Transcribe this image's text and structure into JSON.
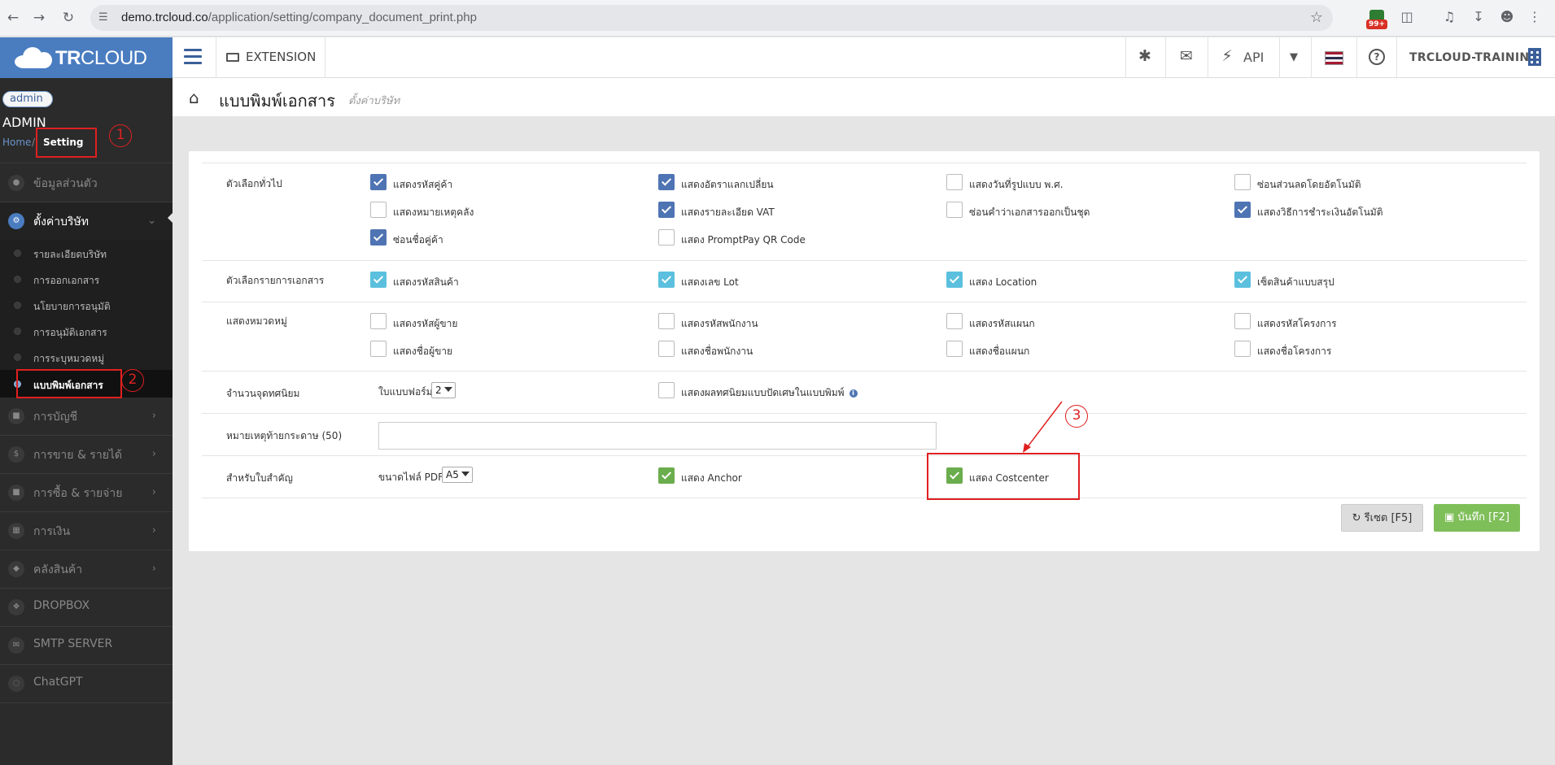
{
  "browser": {
    "url_host": "demo.trcloud.co",
    "url_path": "/application/setting/company_document_print.php",
    "ext_badge": "99+"
  },
  "topbar": {
    "brand_bold": "TR",
    "brand_rest": "CLOUD",
    "extension_label": "EXTENSION",
    "api_label": "API",
    "company_name": "TRCLOUD-TRAINING"
  },
  "sidebar": {
    "avatar_alt": "admin",
    "user": "ADMIN",
    "crumb_home": "Home",
    "crumb_current": "Setting",
    "items": [
      {
        "label": "ข้อมูลส่วนตัว"
      },
      {
        "label": "ตั้งค่าบริษัท"
      },
      {
        "label": "การบัญชี"
      },
      {
        "label": "การขาย & รายได้"
      },
      {
        "label": "การซื้อ & รายจ่าย"
      },
      {
        "label": "การเงิน"
      },
      {
        "label": "คลังสินค้า"
      },
      {
        "label": "DROPBOX"
      },
      {
        "label": "SMTP SERVER"
      },
      {
        "label": "ChatGPT"
      }
    ],
    "subitems": [
      {
        "label": "รายละเอียดบริษัท"
      },
      {
        "label": "การออกเอกสาร"
      },
      {
        "label": "นโยบายการอนุมัติ"
      },
      {
        "label": "การอนุมัติเอกสาร"
      },
      {
        "label": "การระบุหมวดหมู่"
      },
      {
        "label": "แบบพิมพ์เอกสาร"
      }
    ]
  },
  "page": {
    "title": "แบบพิมพ์เอกสาร",
    "subtitle": "ตั้งค่าบริษัท"
  },
  "form": {
    "general": {
      "label": "ตัวเลือกทั่วไป",
      "options": [
        {
          "label": "แสดงรหัสคู่ค้า",
          "checked": true
        },
        {
          "label": "แสดงอัตราแลกเปลี่ยน",
          "checked": true
        },
        {
          "label": "แสดงวันที่รูปแบบ พ.ศ.",
          "checked": false
        },
        {
          "label": "ซ่อนส่วนลดโดยอัตโนมัติ",
          "checked": false
        },
        {
          "label": "แสดงหมายเหตุคลัง",
          "checked": false
        },
        {
          "label": "แสดงรายละเอียด VAT",
          "checked": true
        },
        {
          "label": "ซ่อนคำว่าเอกสารออกเป็นชุด",
          "checked": false
        },
        {
          "label": "แสดงวิธีการชำระเงินอัตโนมัติ",
          "checked": true
        },
        {
          "label": "ซ่อนชื่อคู่ค้า",
          "checked": true
        },
        {
          "label": "แสดง PromptPay QR Code",
          "checked": false
        }
      ]
    },
    "items": {
      "label": "ตัวเลือกรายการเอกสาร",
      "options": [
        {
          "label": "แสดงรหัสสินค้า",
          "checked": true
        },
        {
          "label": "แสดงเลข Lot",
          "checked": true
        },
        {
          "label": "แสดง Location",
          "checked": true
        },
        {
          "label": "เซ็ตสินค้าแบบสรุป",
          "checked": true
        }
      ]
    },
    "category": {
      "label": "แสดงหมวดหมู่",
      "options": [
        {
          "label": "แสดงรหัสผู้ขาย",
          "checked": false
        },
        {
          "label": "แสดงรหัสพนักงาน",
          "checked": false
        },
        {
          "label": "แสดงรหัสแผนก",
          "checked": false
        },
        {
          "label": "แสดงรหัสโครงการ",
          "checked": false
        },
        {
          "label": "แสดงชื่อผู้ขาย",
          "checked": false
        },
        {
          "label": "แสดงชื่อพนักงาน",
          "checked": false
        },
        {
          "label": "แสดงชื่อแผนก",
          "checked": false
        },
        {
          "label": "แสดงชื่อโครงการ",
          "checked": false
        }
      ]
    },
    "decimals": {
      "label": "จำนวนจุดทศนิยม",
      "select_label": "ใบแบบฟอร์ม",
      "select_value": "2",
      "option_label": "แสดงผลทศนิยมแบบปัดเศษในแบบพิมพ์",
      "option_checked": false
    },
    "footer_note": {
      "label": "หมายเหตุท้ายกระดาษ (50)",
      "value": ""
    },
    "important": {
      "label": "สำหรับใบสำคัญ",
      "select_label": "ขนาดไฟล์ PDF",
      "select_value": "A5",
      "anchor_label": "แสดง Anchor",
      "anchor_checked": true,
      "costcenter_label": "แสดง Costcenter",
      "costcenter_checked": true
    },
    "buttons": {
      "reset": "รีเซต [F5]",
      "save": "บันทึก [F2]"
    }
  },
  "annotations": {
    "one": "1",
    "two": "2",
    "three": "3",
    "color": "#e02020"
  },
  "colors": {
    "brand": "#4a7cc0",
    "check_blue": "#4f74b3",
    "check_cyan": "#5bc0de",
    "check_green": "#6aad4c"
  }
}
